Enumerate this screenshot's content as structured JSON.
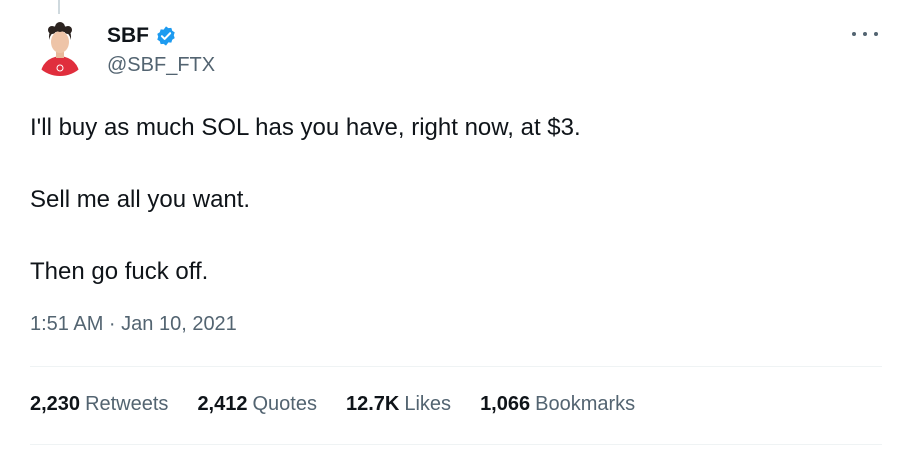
{
  "author": {
    "display_name": "SBF",
    "handle": "@SBF_FTX",
    "verified": true,
    "verified_color": "#1d9bf0",
    "avatar_icon": "profile-avatar-person-red-shirt"
  },
  "tweet": {
    "lines": [
      "I'll buy as much SOL has you have, right now, at $3.",
      "Sell me all you want.",
      "Then go fuck off."
    ],
    "timestamp": "1:51 AM · Jan 10, 2021"
  },
  "stats": [
    {
      "count": "2,230",
      "label": "Retweets"
    },
    {
      "count": "2,412",
      "label": "Quotes"
    },
    {
      "count": "12.7K",
      "label": "Likes"
    },
    {
      "count": "1,066",
      "label": "Bookmarks"
    }
  ],
  "colors": {
    "text_primary": "#0f1419",
    "text_secondary": "#536471",
    "divider": "#eff3f4",
    "accent": "#1d9bf0"
  }
}
